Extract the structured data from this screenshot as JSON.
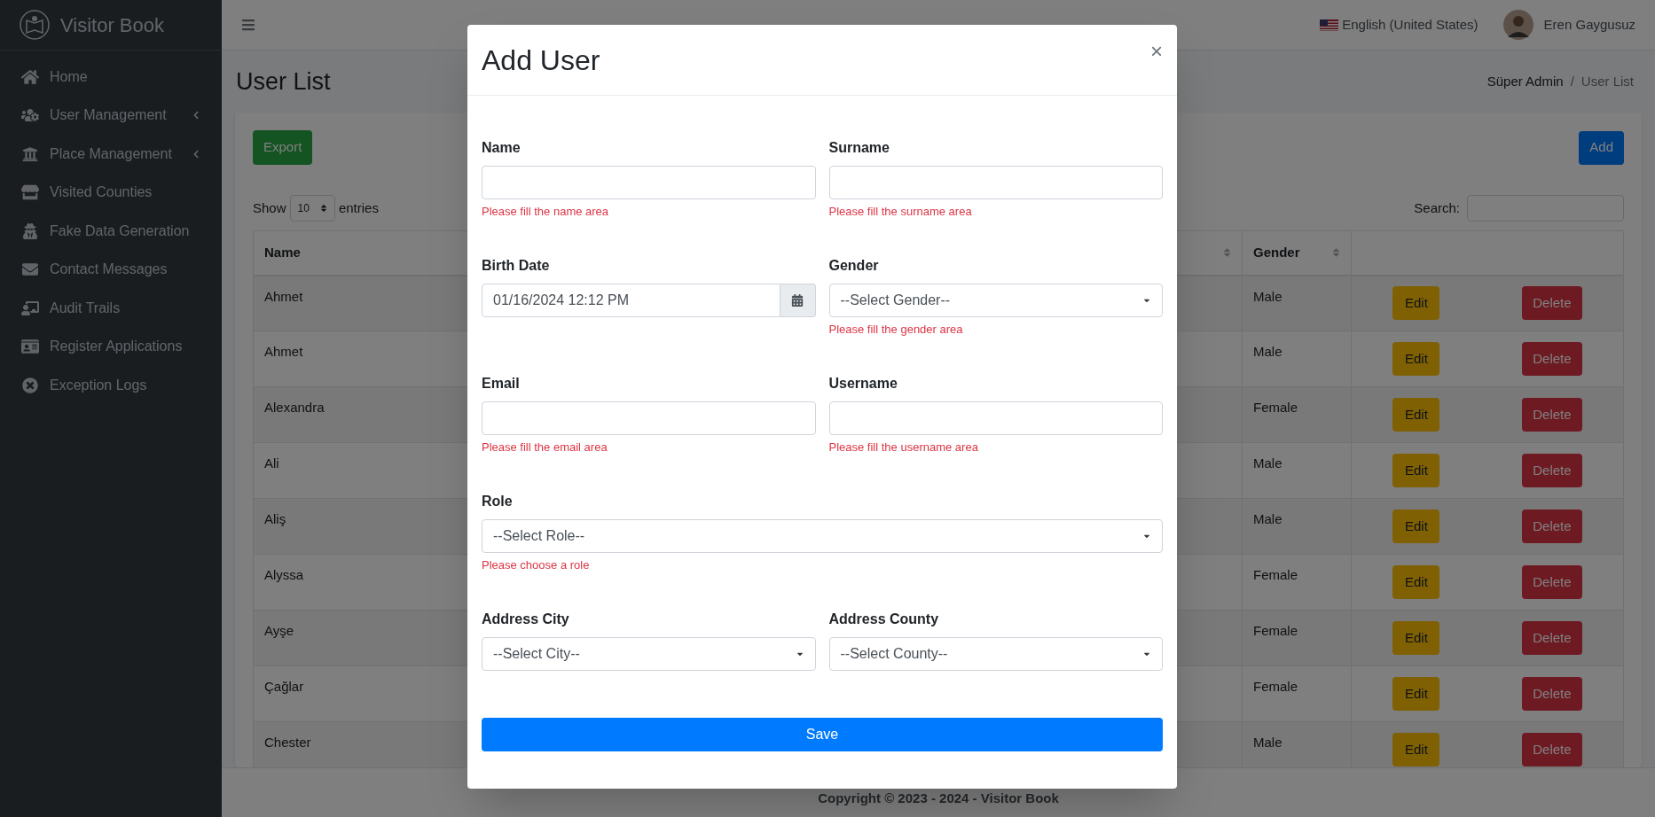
{
  "sidebar": {
    "brand": "Visitor Book",
    "items": [
      {
        "label": "Home",
        "has_submenu": false
      },
      {
        "label": "User Management",
        "has_submenu": true
      },
      {
        "label": "Place Management",
        "has_submenu": true
      },
      {
        "label": "Visited Counties",
        "has_submenu": false
      },
      {
        "label": "Fake Data Generation",
        "has_submenu": false
      },
      {
        "label": "Contact Messages",
        "has_submenu": false
      },
      {
        "label": "Audit Trails",
        "has_submenu": false
      },
      {
        "label": "Register Applications",
        "has_submenu": false
      },
      {
        "label": "Exception Logs",
        "has_submenu": false
      }
    ]
  },
  "header": {
    "language": "English (United States)",
    "user": "Eren Gaygusuz"
  },
  "page": {
    "title": "User List",
    "breadcrumb": [
      "Süper Admin",
      "User List"
    ],
    "breadcrumb_separator": "/"
  },
  "card": {
    "export": "Export",
    "add": "Add",
    "show": "Show",
    "entries_value": "10",
    "entries": "entries",
    "search_label": "Search:"
  },
  "table": {
    "columns": [
      "Name",
      "Gender"
    ],
    "rows": [
      {
        "name": "Ahmet",
        "gender": "Male",
        "edit": "Edit",
        "delete": "Delete"
      },
      {
        "name": "Ahmet",
        "gender": "Male",
        "edit": "Edit",
        "delete": "Delete"
      },
      {
        "name": "Alexandra",
        "gender": "Female",
        "edit": "Edit",
        "delete": "Delete"
      },
      {
        "name": "Ali",
        "gender": "Male",
        "edit": "Edit",
        "delete": "Delete"
      },
      {
        "name": "Aliş",
        "gender": "Male",
        "edit": "Edit",
        "delete": "Delete"
      },
      {
        "name": "Alyssa",
        "gender": "Female",
        "edit": "Edit",
        "delete": "Delete"
      },
      {
        "name": "Ayşe",
        "gender": "Female",
        "edit": "Edit",
        "delete": "Delete"
      },
      {
        "name": "Çağlar",
        "gender": "Female",
        "edit": "Edit",
        "delete": "Delete"
      },
      {
        "name": "Chester",
        "gender": "Male",
        "edit": "Edit",
        "delete": "Delete"
      }
    ]
  },
  "footer": "Copyright © 2023 - 2024 - Visitor Book",
  "modal": {
    "title": "Add User",
    "close": "×",
    "save": "Save",
    "rows": [
      [
        {
          "kind": "text",
          "label": "Name",
          "error": "Please fill the name area"
        },
        {
          "kind": "text",
          "label": "Surname",
          "error": "Please fill the surname area"
        }
      ],
      [
        {
          "kind": "date",
          "label": "Birth Date",
          "value": "01/16/2024 12:12 PM"
        },
        {
          "kind": "select",
          "label": "Gender",
          "value": "--Select Gender--",
          "error": "Please fill the gender area"
        }
      ],
      [
        {
          "kind": "text",
          "label": "Email",
          "error": "Please fill the email area"
        },
        {
          "kind": "text",
          "label": "Username",
          "error": "Please fill the username area"
        }
      ],
      [
        {
          "kind": "select",
          "label": "Role",
          "value": "--Select Role--",
          "error": "Please choose a role"
        }
      ],
      [
        {
          "kind": "select",
          "label": "Address City",
          "value": "--Select City--"
        },
        {
          "kind": "select",
          "label": "Address County",
          "value": "--Select County--"
        }
      ]
    ]
  }
}
